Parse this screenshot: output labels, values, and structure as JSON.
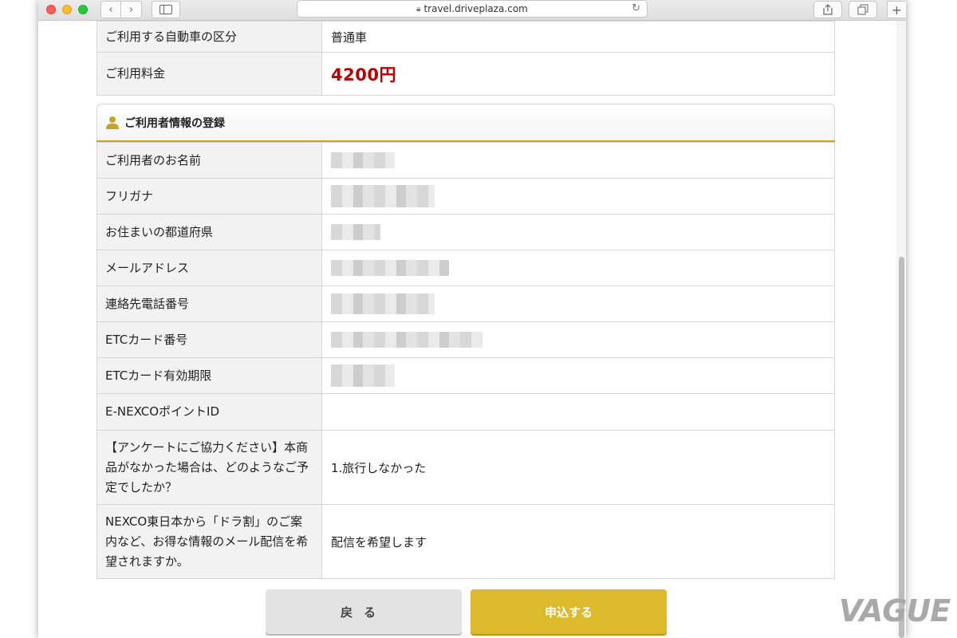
{
  "browser": {
    "url": "travel.driveplaza.com",
    "new_tab": "+"
  },
  "summary": {
    "vehicle_label": "ご利用する自動車の区分",
    "vehicle_value": "普通車",
    "fee_label": "ご利用料金",
    "fee_value": "4200円"
  },
  "section": {
    "title": "ご利用者情報の登録"
  },
  "rows": [
    {
      "label": "ご利用者のお名前",
      "value": ""
    },
    {
      "label": "フリガナ",
      "value": ""
    },
    {
      "label": "お住まいの都道府県",
      "value": ""
    },
    {
      "label": "メールアドレス",
      "value": ""
    },
    {
      "label": "連絡先電話番号",
      "value": ""
    },
    {
      "label": "ETCカード番号",
      "value": ""
    },
    {
      "label": "ETCカード有効期限",
      "value": ""
    },
    {
      "label": "E-NEXCOポイントID",
      "value": ""
    },
    {
      "label": "【アンケートにご協力ください】本商品がなかった場合は、どのようなご予定でしたか？",
      "value": "1.旅行しなかった"
    },
    {
      "label": "NEXCO東日本から「ドラ割」のご案内など、お得な情報のメール配信を希望されますか。",
      "value": "配信を希望します"
    }
  ],
  "actions": {
    "back": "戻る",
    "submit": "申込する"
  },
  "watermark": "VAGUE",
  "colors": {
    "accent_gold": "#c8a426",
    "submit_button": "#dcba2c",
    "price_red": "#b80000"
  }
}
